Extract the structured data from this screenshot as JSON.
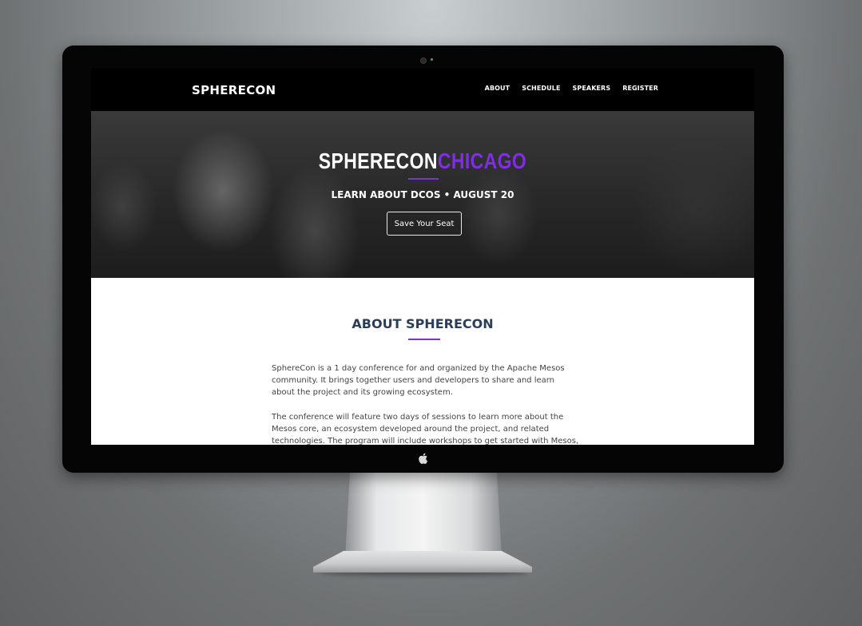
{
  "navbar": {
    "brand": "SPHERECON",
    "links": [
      "ABOUT",
      "SCHEDULE",
      "SPEAKERS",
      "REGISTER"
    ]
  },
  "hero": {
    "title_white": "SPHERECON",
    "title_purple": "CHICAGO",
    "subtitle": "LEARN ABOUT DCOS • AUGUST 20",
    "cta_label": "Save Your Seat"
  },
  "about": {
    "title": "ABOUT SPHERECON",
    "paragraph_1": "SphereCon is a 1 day conference for and organized by the Apache Mesos community. It brings together users and developers to share and learn about the project and its growing ecosystem.",
    "paragraph_2": "The conference will feature two days of sessions to learn more about the Mesos core, an ecosystem developed around the project, and related technologies. The program will include workshops to get started with Mesos, keynote speakers"
  },
  "colors": {
    "accent": "#7e2fe0",
    "heading": "#2c3e57",
    "navbar_bg": "#000000"
  }
}
